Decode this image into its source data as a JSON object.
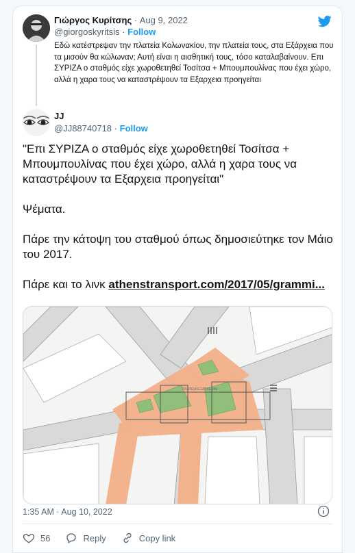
{
  "quoted": {
    "name": "Γιώργος Κυρίτσης",
    "date": "· Aug 9, 2022",
    "handle": "@giorgoskyritsis",
    "sep": "·",
    "follow": "Follow",
    "text": "Εδώ κατέστρεψαν την πλατεία Κολωνακίου, την πλατεία τους, στα Εξάρχεια που τα μισούν θα κώλωναν; Αυτή είναι η αισθητική τους, τόσο καταλαβαίνουν. Επι ΣΥΡΙΖΑ ο σταθμός είχε χωροθετηθεί Τοσίτσα + Μπουμπουλίνας που έχει χώρο, αλλά η χαρα τους να καταστρέψουν τα Εξαρχεια προηγείται"
  },
  "tweet": {
    "name": "JJ",
    "handle": "@JJ88740718",
    "sep": "·",
    "follow": "Follow",
    "p1": "\"Επι ΣΥΡΙΖΑ ο σταθμός είχε χωροθετηθεί Τοσίτσα + Μπουμπουλίνας που έχει χώρο, αλλά η χαρα τους να καταστρέψουν τα Εξαρχεια προηγείται\"",
    "p2": "Ψέματα.",
    "p3": "Πάρε την κάτοψη του σταθμού όπως δημοσιεύτηκε τον Μάιο του 2017.",
    "p4_prefix": "Πάρε και το λινκ ",
    "link": "athenstransport.com/2017/05/grammi...",
    "time": "1:35 AM · Aug 10, 2022",
    "map_label": "ΠΛΑΤΕΙΑ ΕΞΑΡΧΕΙΩΝ"
  },
  "actions": {
    "likes": "56",
    "reply": "Reply",
    "copy": "Copy link"
  },
  "colors": {
    "accent": "#1d9bf0",
    "text": "#0f1419",
    "muted": "#536471",
    "like_icon": "#536471"
  },
  "icons": [
    "twitter-bird-icon",
    "info-icon",
    "heart-icon",
    "reply-icon",
    "link-icon"
  ]
}
